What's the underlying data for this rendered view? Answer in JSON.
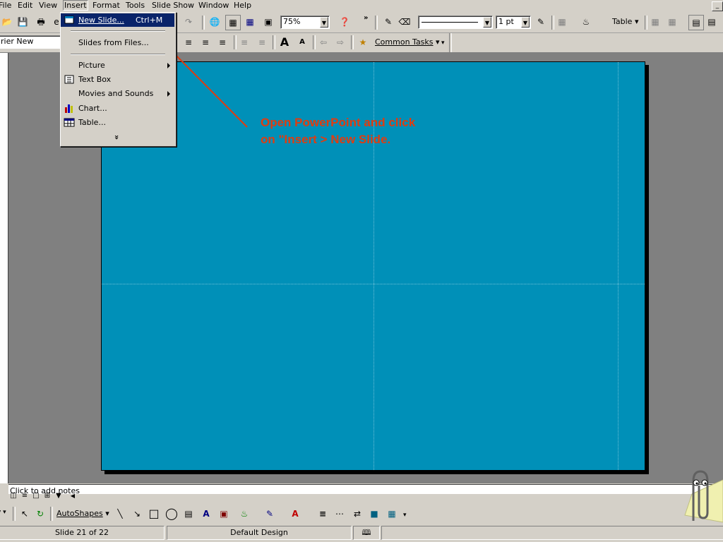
{
  "menubar": {
    "items": [
      "File",
      "Edit",
      "View",
      "Insert",
      "Format",
      "Tools",
      "Slide Show",
      "Window",
      "Help"
    ]
  },
  "toolbar": {
    "zoom": "75%",
    "line_weight": "1 pt",
    "table_label": "Table"
  },
  "formatting": {
    "font": "rier New",
    "common_tasks": "Common Tasks"
  },
  "insert_menu": {
    "items": [
      {
        "label": "New Slide...",
        "shortcut": "Ctrl+M",
        "icon": "new-slide-icon",
        "highlighted": true
      },
      {
        "label": "Slides from Files...",
        "shortcut": "",
        "icon": ""
      },
      {
        "label": "Picture",
        "shortcut": "",
        "icon": "",
        "submenu": true
      },
      {
        "label": "Text Box",
        "shortcut": "",
        "icon": "text-box-icon"
      },
      {
        "label": "Movies and Sounds",
        "shortcut": "",
        "icon": "",
        "submenu": true
      },
      {
        "label": "Chart...",
        "shortcut": "",
        "icon": "chart-icon"
      },
      {
        "label": "Table...",
        "shortcut": "",
        "icon": "table-icon"
      }
    ],
    "expand": "»"
  },
  "slide": {
    "background": "#0090b8",
    "annotation_line1": "Open PowerPoint and click",
    "annotation_line2": "on \"Insert > New Slide.",
    "annotation_color": "#e03c10"
  },
  "notes": {
    "placeholder": "Click to add notes"
  },
  "drawing": {
    "autoshapes": "AutoShapes"
  },
  "status": {
    "slide_info": "Slide 21 of 22",
    "design": "Default Design"
  }
}
